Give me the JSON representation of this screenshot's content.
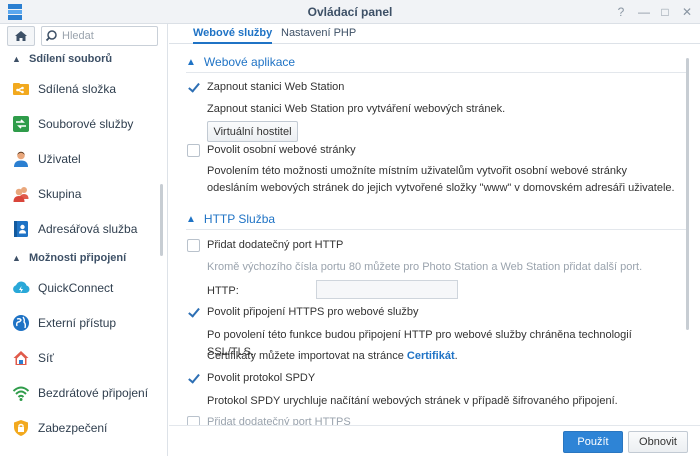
{
  "window": {
    "title": "Ovládací panel",
    "controls": {
      "help": "?",
      "minimize": "—",
      "maximize": "□",
      "close": "✕"
    }
  },
  "nav": {
    "search_placeholder": "Hledat",
    "sections": [
      {
        "title": "Sdílení souborů",
        "items": [
          {
            "label": "Sdílená složka",
            "icon": "shared-folder-icon"
          },
          {
            "label": "Souborové služby",
            "icon": "file-services-icon"
          },
          {
            "label": "Uživatel",
            "icon": "user-icon"
          },
          {
            "label": "Skupina",
            "icon": "group-icon"
          },
          {
            "label": "Adresářová služba",
            "icon": "directory-service-icon"
          }
        ]
      },
      {
        "title": "Možnosti připojení",
        "items": [
          {
            "label": "QuickConnect",
            "icon": "quickconnect-icon"
          },
          {
            "label": "Externí přístup",
            "icon": "external-access-icon"
          },
          {
            "label": "Síť",
            "icon": "network-icon"
          },
          {
            "label": "Bezdrátové připojení",
            "icon": "wireless-icon"
          },
          {
            "label": "Zabezpečení",
            "icon": "security-icon"
          }
        ]
      }
    ]
  },
  "tabs": [
    {
      "label": "Webové služby",
      "active": true
    },
    {
      "label": "Nastavení PHP",
      "active": false
    }
  ],
  "web_apps": {
    "title": "Webové aplikace",
    "enable_web_station": {
      "label": "Zapnout stanici Web Station",
      "checked": true
    },
    "enable_web_station_desc": "Zapnout stanici Web Station pro vytváření webových stránek.",
    "virtual_host_button": "Virtuální hostitel",
    "personal_site": {
      "label": "Povolit osobní webové stránky",
      "checked": false
    },
    "personal_site_desc": "Povolením této možnosti umožníte místním uživatelům vytvořit osobní webové stránky odesláním webových stránek do jejich vytvořené složky \"www\" v domovském adresáři uživatele."
  },
  "http_service": {
    "title": "HTTP Služba",
    "extra_http_port": {
      "label": "Přidat dodatečný port HTTP",
      "checked": false
    },
    "extra_http_port_desc": "Kromě výchozího čísla portu 80 můžete pro Photo Station a Web Station přidat další port.",
    "http_label": "HTTP:",
    "http_value": "",
    "https_connection": {
      "label": "Povolit připojení HTTPS pro webové služby",
      "checked": true
    },
    "https_desc": "Po povolení této funkce budou připojení HTTP pro webové služby chráněna technologií SSL/TLS.",
    "cert_text": "Certifikáty můžete importovat na stránce",
    "cert_link": "Certifikát",
    "cert_end": ".",
    "spdy": {
      "label": "Povolit protokol SPDY",
      "checked": true
    },
    "spdy_desc": "Protokol SPDY urychluje načítání webových stránek v případě šifrovaného připojení.",
    "extra_https_port": {
      "label": "Přidat dodatečný port HTTPS",
      "checked": false
    }
  },
  "footer": {
    "apply_label": "Použít",
    "reset_label": "Obnovit"
  },
  "colors": {
    "accent": "#1f73c5",
    "apply_bg": "#2e84d6"
  }
}
